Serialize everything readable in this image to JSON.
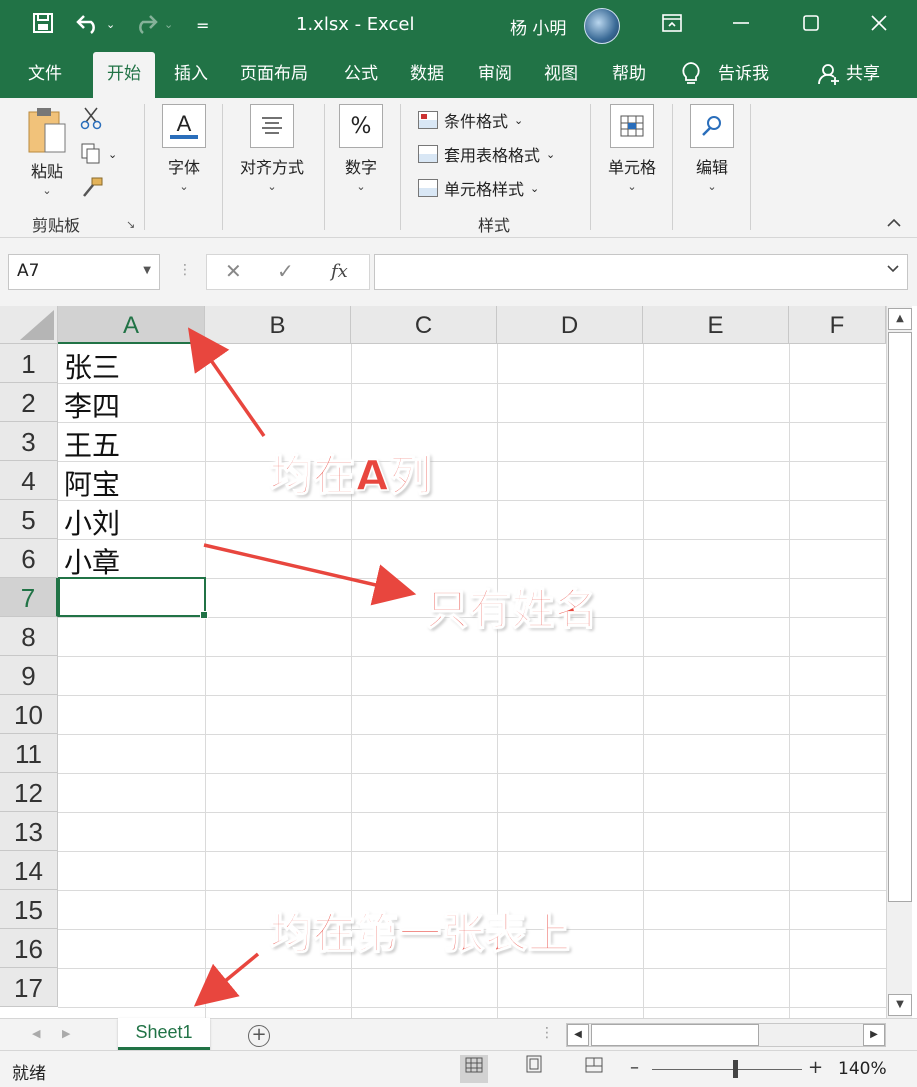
{
  "titlebar": {
    "title": "1.xlsx  -  Excel",
    "user": "杨 小明",
    "save_icon": "save-icon",
    "undo_icon": "undo-icon",
    "redo_icon": "redo-icon",
    "qa_more": "="
  },
  "tabs": [
    "文件",
    "开始",
    "插入",
    "页面布局",
    "公式",
    "数据",
    "审阅",
    "视图",
    "帮助",
    "告诉我",
    "共享"
  ],
  "ribbon": {
    "paste": "粘贴",
    "clipboard": "剪贴板",
    "font": "字体",
    "align": "对齐方式",
    "number": "数字",
    "cond_format": "条件格式",
    "table_format": "套用表格格式",
    "cell_style": "单元格样式",
    "styles": "样式",
    "cells": "单元格",
    "edit": "编辑",
    "font_glyph": "A",
    "number_glyph": "%"
  },
  "formula": {
    "name_box": "A7",
    "fx": "fx",
    "value": ""
  },
  "columns": [
    "A",
    "B",
    "C",
    "D",
    "E",
    "F"
  ],
  "rows": [
    "1",
    "2",
    "3",
    "4",
    "5",
    "6",
    "7",
    "8",
    "9",
    "10",
    "11",
    "12",
    "13",
    "14",
    "15",
    "16",
    "17"
  ],
  "cells_A": [
    "张三",
    "李四",
    "王五",
    "阿宝",
    "小刘",
    "小章"
  ],
  "sheet_tab": "Sheet1",
  "status": {
    "ready": "就绪",
    "zoom": "140%",
    "zoom_level": 1.4
  },
  "annotations": {
    "col": "均在A列",
    "names": "只有姓名",
    "sheet": "均在第一张表上"
  },
  "colors": {
    "accent": "#217346",
    "annotation": "#e8463e"
  }
}
